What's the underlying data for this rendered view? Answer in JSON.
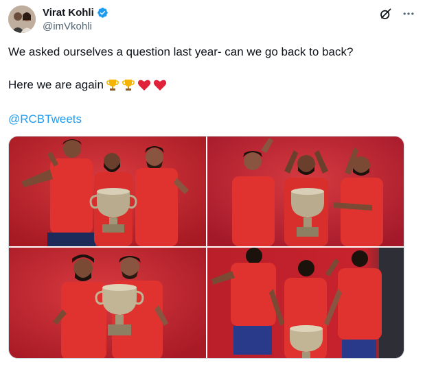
{
  "author": {
    "display_name": "Virat Kohli",
    "handle": "@imVkohli",
    "verified": true,
    "avatar_icon": "profile-photo"
  },
  "actions": {
    "grok_icon": "grok-icon",
    "more_icon": "more-options-icon"
  },
  "tweet": {
    "line1": "We asked ourselves a question last year- can we go back to back?",
    "line2": "Here we are again",
    "emojis": [
      "trophy",
      "trophy",
      "red-heart",
      "red-heart"
    ],
    "mention": "@RCBTweets"
  },
  "media": {
    "photo_count": 4,
    "photos": [
      {
        "name": "photo-1"
      },
      {
        "name": "photo-2"
      },
      {
        "name": "photo-3"
      },
      {
        "name": "photo-4"
      }
    ]
  },
  "colors": {
    "text": "#0f1419",
    "secondary": "#536471",
    "link": "#1d9bf0",
    "verified": "#1d9bf0",
    "backdrop_red": "#c8232e",
    "jersey_red": "#e2332f"
  }
}
